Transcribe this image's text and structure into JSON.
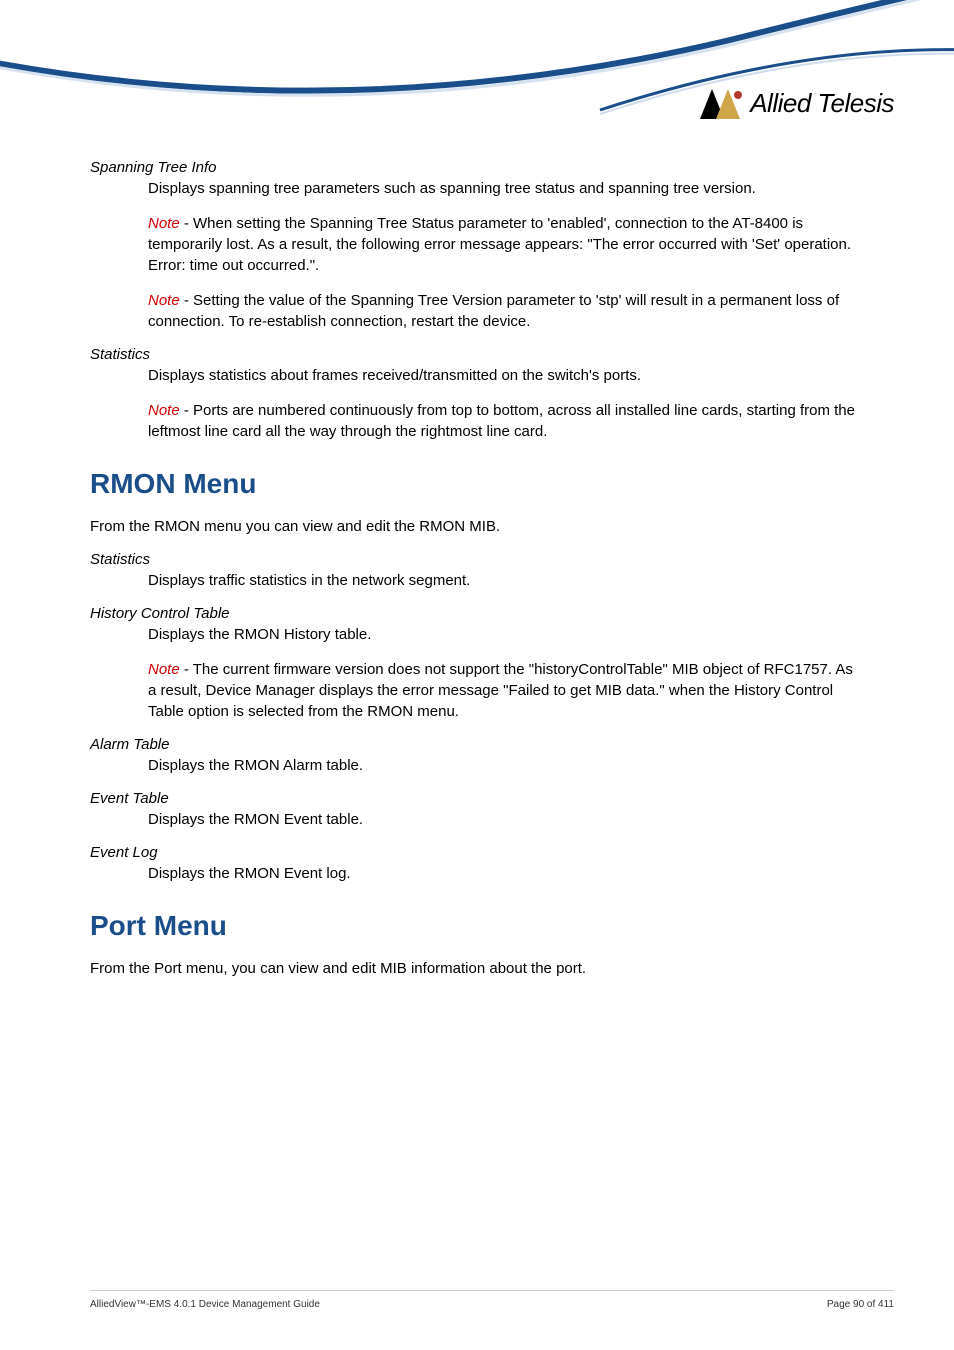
{
  "logo_text": "Allied Telesis",
  "sections": {
    "spanning_tree_info": {
      "term": "Spanning Tree Info",
      "desc": "Displays spanning tree parameters such as spanning tree status and spanning tree version.",
      "note1_label": "Note",
      "note1_text": " - When setting the Spanning Tree Status parameter to 'enabled', connection to the AT-8400 is temporarily lost. As a result, the following error message appears: \"The error occurred with 'Set' operation. Error: time out occurred.\".",
      "note2_label": "Note",
      "note2_text": " - Setting the value of the Spanning Tree Version parameter to 'stp' will result in a permanent loss of connection. To re-establish connection, restart the device."
    },
    "statistics1": {
      "term": "Statistics",
      "desc": "Displays statistics about frames received/transmitted on the switch's ports.",
      "note_label": "Note",
      "note_text": " - Ports are numbered continuously from top to bottom, across all installed line cards, starting from the leftmost line card all the way through the rightmost line card."
    },
    "rmon": {
      "heading": "RMON Menu",
      "intro": "From the RMON menu you can view and edit the RMON MIB.",
      "statistics": {
        "term": "Statistics",
        "desc": "Displays traffic statistics in the network segment."
      },
      "history": {
        "term": "History Control Table",
        "desc": "Displays the RMON History table.",
        "note_label": "Note",
        "note_text": " - The current firmware version does not support the \"historyControlTable\" MIB object of RFC1757. As a result, Device Manager displays the error message \"Failed to get MIB data.\" when the History Control Table option is selected from the RMON menu."
      },
      "alarm": {
        "term": "Alarm Table",
        "desc": "Displays the RMON Alarm table."
      },
      "event_table": {
        "term": "Event Table",
        "desc": "Displays the RMON Event table."
      },
      "event_log": {
        "term": "Event Log",
        "desc": "Displays the RMON Event log."
      }
    },
    "port": {
      "heading": "Port Menu",
      "intro": "From the Port menu, you can view and edit MIB information about the port."
    }
  },
  "footer": {
    "left": "AlliedView™-EMS 4.0.1 Device Management Guide",
    "right": "Page 90 of 411"
  }
}
